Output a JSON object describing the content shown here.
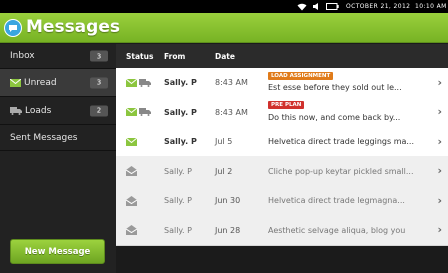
{
  "status_bar": {
    "date": "OCTOBER 21, 2012",
    "time": "10:10 AM",
    "icons": [
      "wifi-icon",
      "speaker-icon",
      "battery-icon"
    ]
  },
  "app": {
    "title": "Messages",
    "icon": "chat-bubble-icon",
    "accent": "#8cc63f"
  },
  "sidebar": {
    "items": [
      {
        "label": "Inbox",
        "count": "3"
      },
      {
        "label": "Unread",
        "count": "3",
        "icon": "envelope-icon"
      },
      {
        "label": "Loads",
        "count": "2",
        "icon": "truck-icon"
      },
      {
        "label": "Sent Messages"
      }
    ],
    "new_message_label": "New Message"
  },
  "table": {
    "headers": {
      "status": "Status",
      "from": "From",
      "date": "Date"
    },
    "rows": [
      {
        "from": "Sally. P",
        "date": "8:43 AM",
        "tag": "LOAD ASSIGNMENT",
        "tag_color": "#e07b1a",
        "preview": "Est esse before they sold out le...",
        "unread": true,
        "icons": [
          "envelope-icon",
          "truck-icon"
        ]
      },
      {
        "from": "Sally. P",
        "date": "8:43 AM",
        "tag": "PRE PLAN",
        "tag_color": "#d0312d",
        "preview": "Do this now, and come back by...",
        "unread": true,
        "icons": [
          "envelope-icon",
          "truck-icon"
        ]
      },
      {
        "from": "Sally. P",
        "date": "Jul 5",
        "preview": "Helvetica direct trade leggings ma...",
        "unread": true,
        "icons": [
          "envelope-icon"
        ]
      },
      {
        "from": "Sally. P",
        "date": "Jul 2",
        "preview": "Cliche pop-up keytar pickled small...",
        "unread": false,
        "icons": [
          "open-envelope-icon"
        ]
      },
      {
        "from": "Sally. P",
        "date": "Jun 30",
        "preview": "Helvetica direct trade legmagna...",
        "unread": false,
        "icons": [
          "open-envelope-icon"
        ]
      },
      {
        "from": "Sally. P",
        "date": "Jun 28",
        "preview": "Aesthetic selvage aliqua, blog you",
        "unread": false,
        "icons": [
          "open-envelope-icon"
        ]
      }
    ]
  }
}
